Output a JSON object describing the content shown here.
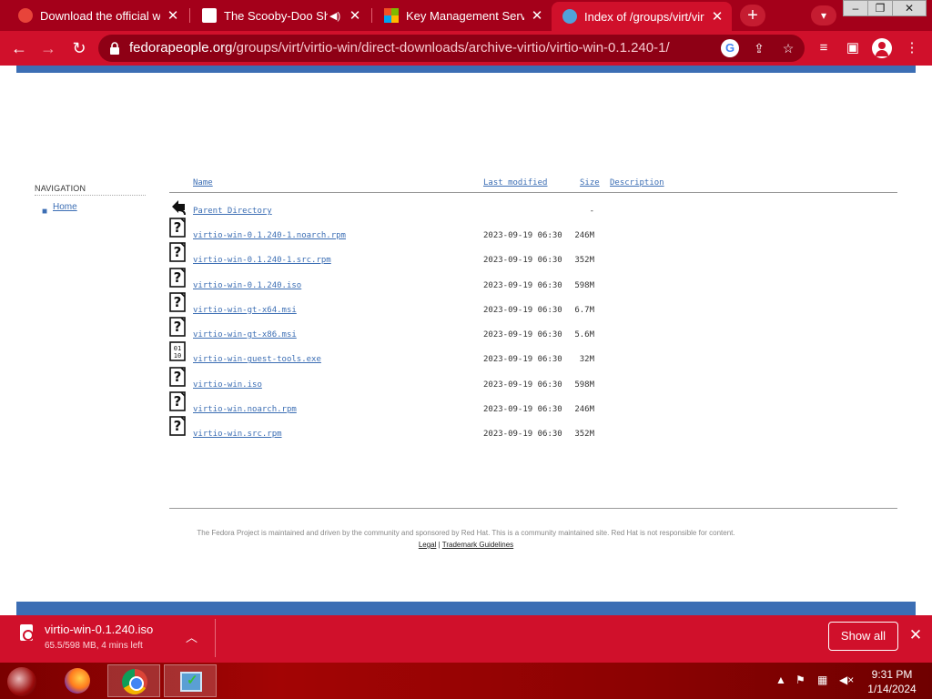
{
  "browser": {
    "tabs": [
      {
        "title": "Download the official win",
        "favicon_color": "#e8443a",
        "active": false
      },
      {
        "title": "The Scooby-Doo Sho",
        "favicon_color": "#ffffff",
        "active": false,
        "audio": true
      },
      {
        "title": "Key Management Service",
        "favicon_color": "#f25022",
        "active": false
      },
      {
        "title": "Index of /groups/virt/virti",
        "favicon_color": "#51a2da",
        "active": true
      }
    ],
    "url": {
      "host": "fedorapeople.org",
      "path": "/groups/virt/virtio-win/direct-downloads/archive-virtio/virtio-win-0.1.240-1/"
    },
    "icons": {
      "back": "arrow-left-icon",
      "forward": "arrow-right-icon",
      "reload": "reload-icon",
      "lock": "lock-icon",
      "google": "google-lens-icon",
      "share": "share-icon",
      "star": "bookmark-star-icon",
      "media": "media-control-icon",
      "sidepanel": "side-panel-icon",
      "profile": "profile-icon",
      "menu": "kebab-menu-icon"
    }
  },
  "page": {
    "nav_heading": "NAVIGATION",
    "nav_links": [
      "Home"
    ],
    "columns": {
      "name": "Name",
      "last_modified": "Last modified",
      "size": "Size",
      "description": "Description"
    },
    "parent": {
      "name": "Parent Directory",
      "size": "-"
    },
    "files": [
      {
        "name": "virtio-win-0.1.240-1.noarch.rpm",
        "modified": "2023-09-19 06:30",
        "size": "246M",
        "icon": "unknown-file-icon"
      },
      {
        "name": "virtio-win-0.1.240-1.src.rpm",
        "modified": "2023-09-19 06:30",
        "size": "352M",
        "icon": "unknown-file-icon"
      },
      {
        "name": "virtio-win-0.1.240.iso",
        "modified": "2023-09-19 06:30",
        "size": "598M",
        "icon": "unknown-file-icon"
      },
      {
        "name": "virtio-win-gt-x64.msi",
        "modified": "2023-09-19 06:30",
        "size": "6.7M",
        "icon": "unknown-file-icon"
      },
      {
        "name": "virtio-win-gt-x86.msi",
        "modified": "2023-09-19 06:30",
        "size": "5.6M",
        "icon": "unknown-file-icon"
      },
      {
        "name": "virtio-win-guest-tools.exe",
        "modified": "2023-09-19 06:30",
        "size": "32M",
        "icon": "binary-file-icon"
      },
      {
        "name": "virtio-win.iso",
        "modified": "2023-09-19 06:30",
        "size": "598M",
        "icon": "unknown-file-icon"
      },
      {
        "name": "virtio-win.noarch.rpm",
        "modified": "2023-09-19 06:30",
        "size": "246M",
        "icon": "unknown-file-icon"
      },
      {
        "name": "virtio-win.src.rpm",
        "modified": "2023-09-19 06:30",
        "size": "352M",
        "icon": "unknown-file-icon"
      }
    ],
    "footer": {
      "text": "The Fedora Project is maintained and driven by the community and sponsored by Red Hat. This is a community maintained site. Red Hat is not responsible for content.",
      "legal": "Legal",
      "separator": "|",
      "trademark": "Trademark Guidelines"
    },
    "accent_color": "#3c6eb4"
  },
  "downloads": {
    "file": "virtio-win-0.1.240.iso",
    "status": "65.5/598 MB, 4 mins left",
    "show_all": "Show all"
  },
  "taskbar": {
    "apps": [
      "firefox-icon",
      "chrome-icon",
      "app-icon"
    ],
    "time": "9:31 PM",
    "date": "1/14/2024"
  },
  "theme": {
    "tabstrip": "#a4001a",
    "toolbar": "#d0102b"
  }
}
